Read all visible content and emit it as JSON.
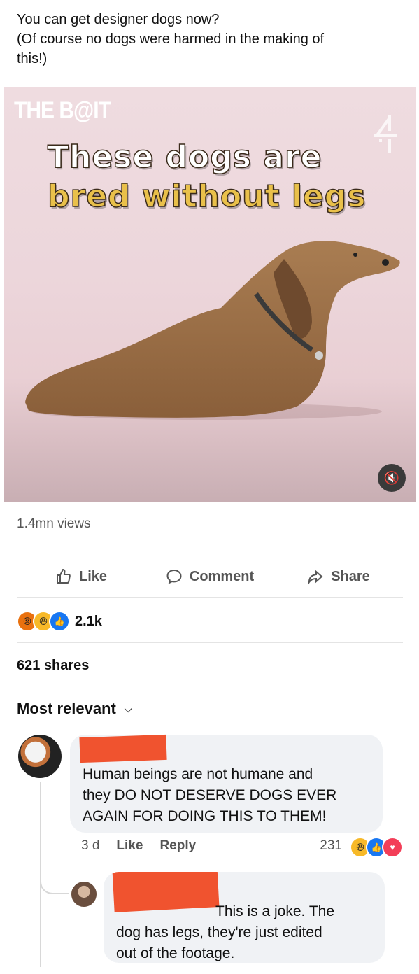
{
  "post": {
    "text_lines": [
      "You can get designer dogs now?",
      "(Of course no dogs were harmed in the making of",
      "this!)"
    ]
  },
  "video": {
    "brand": "THE B@IT",
    "channel_logo": "4",
    "headline_line1": "These dogs are",
    "headline_line2": "bred without legs",
    "mute_icon": "speaker-muted-icon"
  },
  "stats": {
    "views": "1.4mn views",
    "reaction_count": "2.1k",
    "reaction_types": [
      "angry",
      "haha",
      "like"
    ],
    "shares": "621 shares"
  },
  "actions": {
    "like": "Like",
    "comment": "Comment",
    "share": "Share"
  },
  "comments_header": {
    "sort_label": "Most relevant"
  },
  "comments": [
    {
      "author": "",
      "text_lines": [
        "Human beings are not humane and",
        "they DO NOT DESERVE DOGS EVER",
        "AGAIN FOR DOING THIS TO THEM!"
      ],
      "age": "3 d",
      "like": "Like",
      "reply": "Reply",
      "reaction_count": "231",
      "reaction_types": [
        "haha",
        "like",
        "love"
      ]
    },
    {
      "author": "",
      "text_lines": [
        "This is a joke. The",
        "dog has legs, they're just edited",
        "out of the footage."
      ]
    }
  ],
  "colors": {
    "accent_blue": "#1877f2",
    "redaction": "#f0532f",
    "headline_yellow": "#e9c04a"
  }
}
